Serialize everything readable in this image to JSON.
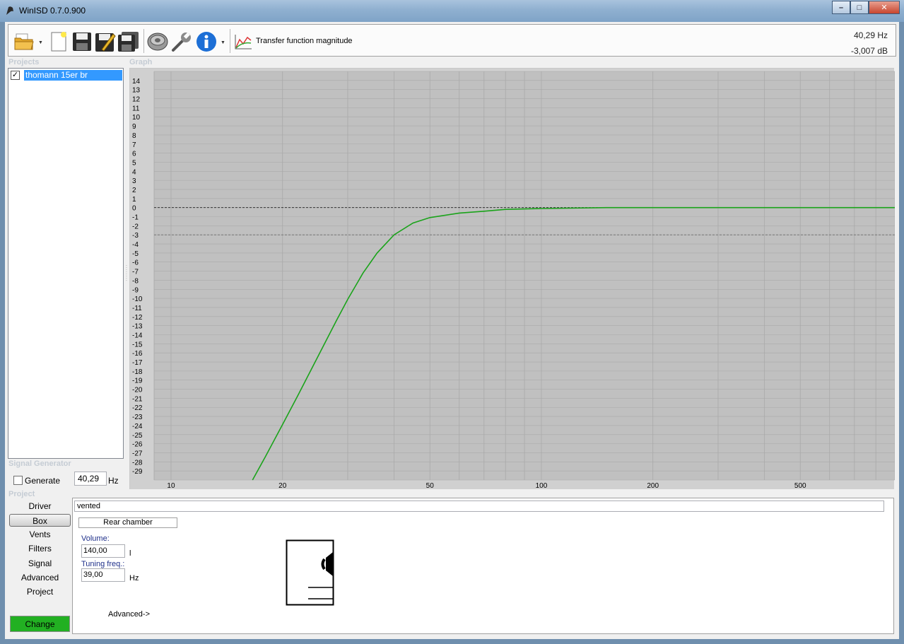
{
  "window": {
    "title": "WinISD 0.7.0.900"
  },
  "toolbar": {
    "label": "Transfer function magnitude",
    "icons": [
      "open-folder-icon",
      "new-project-icon",
      "save-icon",
      "save-as-icon",
      "save-all-icon",
      "driver-icon",
      "tools-icon",
      "info-icon",
      "graph-icon"
    ]
  },
  "readout": {
    "frequency": "40,29 Hz",
    "level": "-3,007 dB"
  },
  "sections": {
    "projects": "Projects",
    "graph": "Graph",
    "signal_generator": "Signal Generator",
    "project": "Project"
  },
  "projects": {
    "items": [
      {
        "name": "thomann 15er br",
        "checked": true
      }
    ]
  },
  "signal_generator": {
    "generate_label": "Generate",
    "frequency": "40,29",
    "unit": "Hz"
  },
  "nav": {
    "items": [
      "Driver",
      "Box",
      "Vents",
      "Filters",
      "Signal",
      "Advanced",
      "Project"
    ],
    "active": "Box",
    "change_label": "Change"
  },
  "editor": {
    "box_type": "vented",
    "rear_chamber_label": "Rear chamber",
    "volume_label": "Volume:",
    "volume_value": "140,00",
    "volume_unit": "l",
    "tuning_label": "Tuning freq.:",
    "tuning_value": "39,00",
    "tuning_unit": "Hz",
    "advanced_label": "Advanced->"
  },
  "chart_data": {
    "type": "line",
    "title": "",
    "xlabel": "",
    "ylabel": "",
    "x_scale": "log",
    "xlim": [
      9,
      900
    ],
    "ylim": [
      -30,
      15
    ],
    "x_tick_labels": [
      10,
      20,
      50,
      100,
      200,
      500
    ],
    "y_tick_labels": [
      14,
      13,
      12,
      11,
      10,
      9,
      8,
      7,
      6,
      5,
      4,
      3,
      2,
      1,
      0,
      -1,
      -2,
      -3,
      -4,
      -5,
      -6,
      -7,
      -8,
      -9,
      -10,
      -11,
      -12,
      -13,
      -14,
      -15,
      -16,
      -17,
      -18,
      -19,
      -20,
      -21,
      -22,
      -23,
      -24,
      -25,
      -26,
      -27,
      -28,
      -29
    ],
    "grid": true,
    "reference_lines": [
      0,
      -3
    ],
    "colors": {
      "series": "#1aa31a",
      "plot_bg": "#c0c0c0"
    },
    "series": [
      {
        "x": [
          16.6,
          18,
          20,
          22,
          25,
          28,
          30,
          33,
          36,
          40,
          45,
          50,
          60,
          70,
          80,
          100,
          150,
          200,
          300,
          500,
          800,
          900
        ],
        "y": [
          -30,
          -27.4,
          -23.9,
          -20.7,
          -16.3,
          -12.4,
          -10.1,
          -7.2,
          -5.0,
          -3.0,
          -1.7,
          -1.1,
          -0.6,
          -0.4,
          -0.2,
          -0.1,
          0,
          0,
          0,
          0,
          0,
          0
        ]
      }
    ]
  }
}
